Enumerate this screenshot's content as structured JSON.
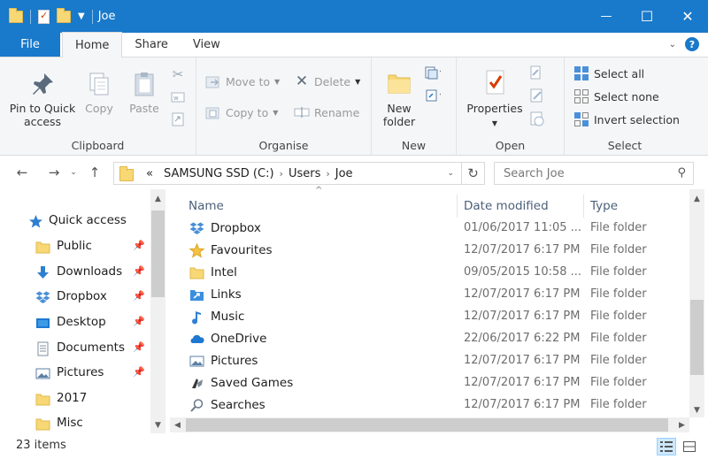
{
  "window": {
    "title": "Joe",
    "controls": {
      "minimize": "—",
      "maximize": "☐",
      "close": "✕"
    }
  },
  "ribbon_tabs": [
    {
      "label": "File"
    },
    {
      "label": "Home"
    },
    {
      "label": "Share"
    },
    {
      "label": "View"
    }
  ],
  "ribbon": {
    "clipboard": {
      "label": "Clipboard",
      "pin_to_quick_access": "Pin to Quick access",
      "copy": "Copy",
      "paste": "Paste"
    },
    "organise": {
      "label": "Organise",
      "move_to": "Move to",
      "copy_to": "Copy to",
      "delete": "Delete",
      "rename": "Rename"
    },
    "new": {
      "label": "New",
      "new_folder": "New folder"
    },
    "open": {
      "label": "Open",
      "properties": "Properties"
    },
    "select": {
      "label": "Select",
      "select_all": "Select all",
      "select_none": "Select none",
      "invert_selection": "Invert selection"
    }
  },
  "address": {
    "overflow": "«",
    "segments": [
      "SAMSUNG SSD (C:)",
      "Users",
      "Joe"
    ]
  },
  "search": {
    "placeholder": "Search Joe"
  },
  "nav_pane": [
    {
      "label": "Quick access",
      "icon": "star-icon",
      "pinned": false
    },
    {
      "label": "Public",
      "icon": "folder-icon",
      "pinned": true
    },
    {
      "label": "Downloads",
      "icon": "download-icon",
      "pinned": true
    },
    {
      "label": "Dropbox",
      "icon": "dropbox-icon",
      "pinned": true
    },
    {
      "label": "Desktop",
      "icon": "desktop-icon",
      "pinned": true
    },
    {
      "label": "Documents",
      "icon": "documents-icon",
      "pinned": true
    },
    {
      "label": "Pictures",
      "icon": "pictures-icon",
      "pinned": true
    },
    {
      "label": "2017",
      "icon": "folder-icon",
      "pinned": false
    },
    {
      "label": "Misc",
      "icon": "folder-icon",
      "pinned": false
    }
  ],
  "columns": {
    "name": "Name",
    "date_modified": "Date modified",
    "type": "Type"
  },
  "files": [
    {
      "name": "Dropbox",
      "date": "01/06/2017 11:05 ...",
      "type": "File folder",
      "icon": "dropbox-icon"
    },
    {
      "name": "Favourites",
      "date": "12/07/2017 6:17 PM",
      "type": "File folder",
      "icon": "star-icon"
    },
    {
      "name": "Intel",
      "date": "09/05/2015 10:58 ...",
      "type": "File folder",
      "icon": "folder-icon"
    },
    {
      "name": "Links",
      "date": "12/07/2017 6:17 PM",
      "type": "File folder",
      "icon": "links-icon"
    },
    {
      "name": "Music",
      "date": "12/07/2017 6:17 PM",
      "type": "File folder",
      "icon": "music-icon"
    },
    {
      "name": "OneDrive",
      "date": "22/06/2017 6:22 PM",
      "type": "File folder",
      "icon": "onedrive-icon"
    },
    {
      "name": "Pictures",
      "date": "12/07/2017 6:17 PM",
      "type": "File folder",
      "icon": "pictures-icon"
    },
    {
      "name": "Saved Games",
      "date": "12/07/2017 6:17 PM",
      "type": "File folder",
      "icon": "saved-games-icon"
    },
    {
      "name": "Searches",
      "date": "12/07/2017 6:17 PM",
      "type": "File folder",
      "icon": "search-icon"
    }
  ],
  "status": {
    "item_count": "23 items"
  },
  "colors": {
    "accent": "#1979ca",
    "ribbon_bg": "#f5f6f7",
    "folder": "#f8d775"
  }
}
